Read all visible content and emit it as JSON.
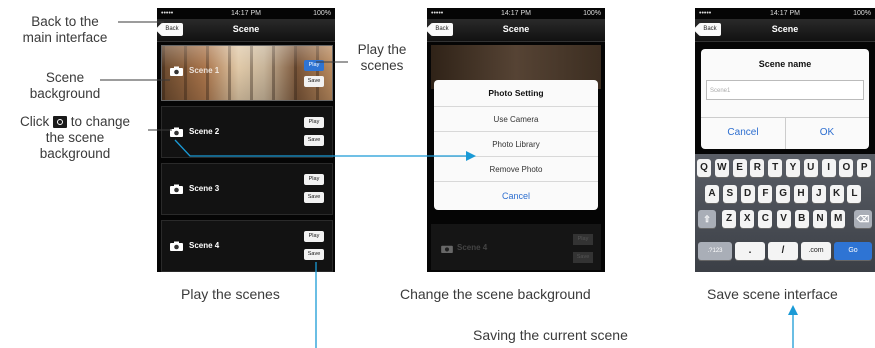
{
  "annotations": {
    "back": "Back to the\nmain interface",
    "scene_background": "Scene\nbackground",
    "click_change_prefix": "Click",
    "click_change_suffix": "to change",
    "click_change_rest": "the scene\nbackground",
    "play_scenes_side": "Play the\nscenes"
  },
  "captions": {
    "phone1": "Play the scenes",
    "phone2": "Change the scene background",
    "phone3": "Save scene interface",
    "saving": "Saving the current scene"
  },
  "status": {
    "carrier": "•••••",
    "time": "14:17 PM",
    "battery": "100%"
  },
  "nav": {
    "title": "Scene",
    "back_label": "Back"
  },
  "scenes": [
    {
      "name": "Scene 1",
      "play": "Play",
      "save": "Save"
    },
    {
      "name": "Scene 2",
      "play": "Play",
      "save": "Save"
    },
    {
      "name": "Scene 3",
      "play": "Play",
      "save": "Save"
    },
    {
      "name": "Scene 4",
      "play": "Play",
      "save": "Save"
    }
  ],
  "photo_setting": {
    "title": "Photo Setting",
    "options": [
      "Use Camera",
      "Photo Library",
      "Remove Photo"
    ],
    "cancel": "Cancel"
  },
  "scene_name_dialog": {
    "title": "Scene name",
    "input_value": "Scene1",
    "cancel": "Cancel",
    "ok": "OK"
  },
  "keyboard": {
    "row1": [
      "Q",
      "W",
      "E",
      "R",
      "T",
      "Y",
      "U",
      "I",
      "O",
      "P"
    ],
    "row2": [
      "A",
      "S",
      "D",
      "F",
      "G",
      "H",
      "J",
      "K",
      "L"
    ],
    "row3": [
      "Z",
      "X",
      "C",
      "V",
      "B",
      "N",
      "M"
    ],
    "bottom": {
      "numbers": ".?123",
      "dot": ".",
      "slash": "/",
      "com": ".com",
      "go": "Go"
    }
  },
  "colors": {
    "accent": "#1a9ad6",
    "ios_blue": "#2e74d4"
  }
}
